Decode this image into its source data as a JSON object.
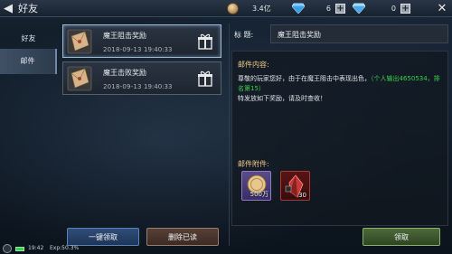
{
  "header": {
    "title": "好友",
    "currency_amount": "3.4亿",
    "gem_count": "6",
    "bound_gem_count": "0"
  },
  "tabs": [
    {
      "label": "好友",
      "selected": false
    },
    {
      "label": "邮件",
      "selected": true
    }
  ],
  "mails": [
    {
      "title": "魔王阻击奖励",
      "date": "2018-09-13",
      "time": "19:40:33",
      "selected": true
    },
    {
      "title": "魔王击败奖励",
      "date": "2018-09-13",
      "time": "19:40:33",
      "selected": false
    }
  ],
  "detail": {
    "title_label": "标  题:",
    "title": "魔王阻击奖励",
    "content_label": "邮件内容:",
    "body_part1": "尊敬的玩家您好，由于在魔王阻击中表现出色，",
    "body_highlight": "（个人输出4650534，排名第15）",
    "body_part2": "特发放如下奖励，请及时查收！",
    "attach_label": "邮件附件:",
    "attachments": [
      {
        "name": "gold-coin",
        "qty": "500万"
      },
      {
        "name": "red-crystal",
        "qty": "30"
      }
    ]
  },
  "buttons": {
    "claim_all": "一键领取",
    "delete_read": "删除已读",
    "claim": "领取"
  },
  "status": {
    "time": "19:42",
    "exp": "Exp:50.3%"
  },
  "colors": {
    "accent_gold": "#f0c88a",
    "highlight_green": "#3ad04a"
  }
}
